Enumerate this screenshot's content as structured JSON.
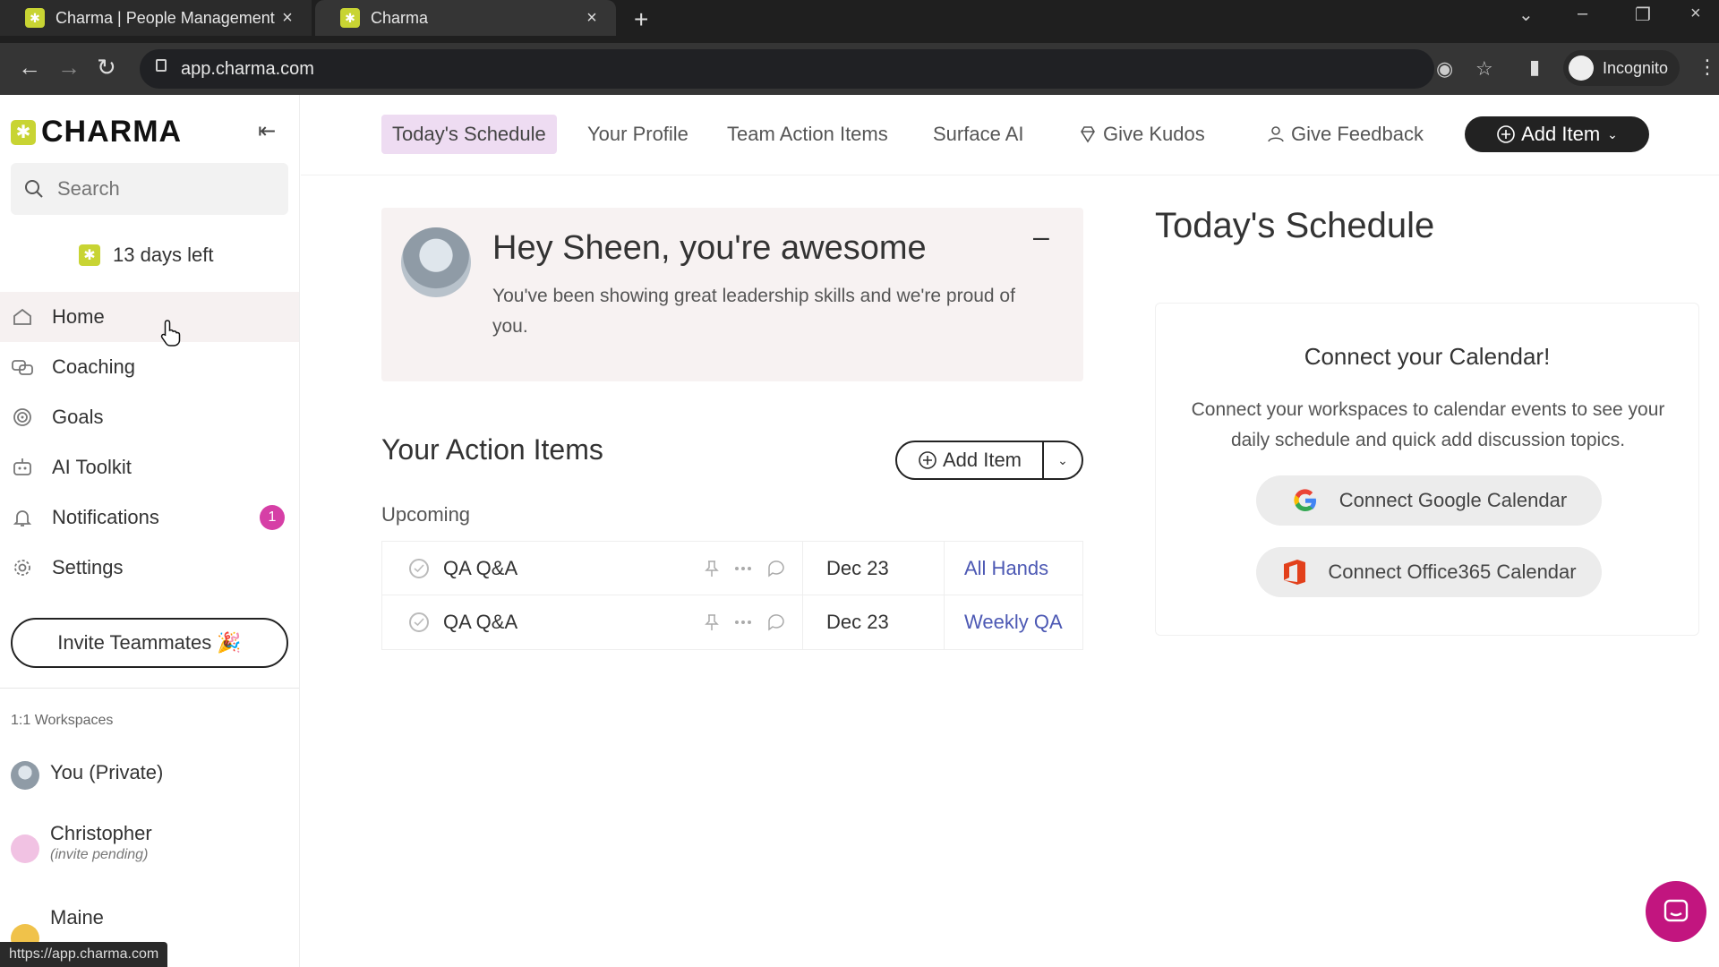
{
  "browser": {
    "tabs": [
      {
        "title": "Charma | People Management S"
      },
      {
        "title": "Charma"
      }
    ],
    "url": "app.charma.com",
    "incognito_label": "Incognito",
    "status_url": "https://app.charma.com"
  },
  "sidebar": {
    "brand": "CHARMA",
    "search_placeholder": "Search",
    "trial_text": "13 days left",
    "nav": [
      {
        "label": "Home",
        "icon": "home-icon",
        "active": true
      },
      {
        "label": "Coaching",
        "icon": "coaching-icon"
      },
      {
        "label": "Goals",
        "icon": "goals-icon"
      },
      {
        "label": "AI Toolkit",
        "icon": "robot-icon"
      },
      {
        "label": "Notifications",
        "icon": "bell-icon",
        "count": "1"
      },
      {
        "label": "Settings",
        "icon": "gear-icon"
      }
    ],
    "invite_label": "Invite Teammates 🎉",
    "workspaces_label": "1:1 Workspaces",
    "workspaces": [
      {
        "name": "You (Private)"
      },
      {
        "name": "Christopher",
        "sub": "(invite pending)"
      },
      {
        "name": "Maine"
      }
    ]
  },
  "topnav": {
    "items": [
      {
        "label": "Today's Schedule",
        "active": true
      },
      {
        "label": "Your Profile"
      },
      {
        "label": "Team Action Items"
      },
      {
        "label": "Surface AI"
      },
      {
        "label": "Give Kudos",
        "icon": "gem-icon"
      },
      {
        "label": "Give Feedback",
        "icon": "feedback-icon"
      }
    ],
    "add_item_label": "Add Item"
  },
  "kudos": {
    "heading": "Hey Sheen, you're awesome",
    "body": "You've been showing great leadership skills and we're proud of you."
  },
  "action_items": {
    "title": "Your Action Items",
    "add_label": "Add Item",
    "section": "Upcoming",
    "rows": [
      {
        "title": "QA Q&A",
        "date": "Dec 23",
        "meeting": "All Hands"
      },
      {
        "title": "QA Q&A",
        "date": "Dec 23",
        "meeting": "Weekly QA"
      }
    ]
  },
  "schedule": {
    "title": "Today's Schedule",
    "card_heading": "Connect your Calendar!",
    "card_body": "Connect your workspaces to calendar events to see your daily schedule and quick add discussion topics.",
    "google_label": "Connect Google Calendar",
    "office_label": "Connect Office365 Calendar"
  },
  "colors": {
    "accent_lime": "#c8d433",
    "active_tab_bg": "#eedcf2",
    "badge_pink": "#d63fa6",
    "link_blue": "#4d59b4",
    "chat_magenta": "#c2157f"
  }
}
